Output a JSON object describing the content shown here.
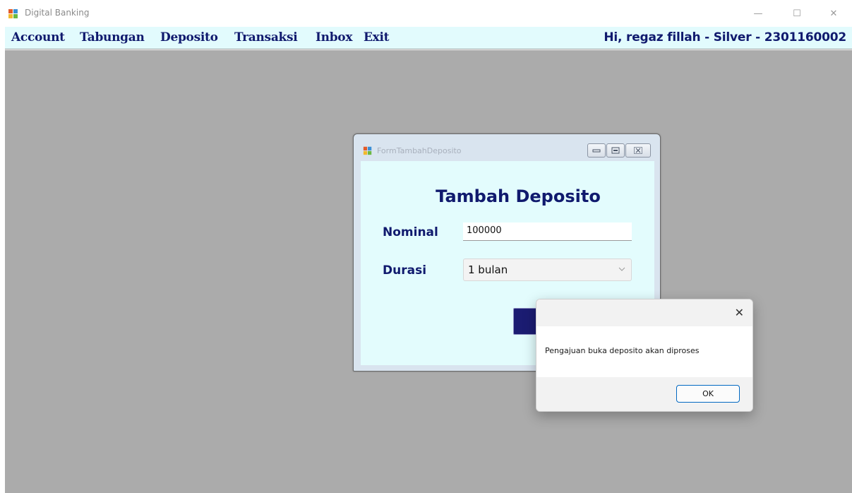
{
  "window": {
    "title": "Digital Banking",
    "controls": {
      "minimize": "—",
      "maximize": "☐",
      "close": "✕"
    }
  },
  "menu": {
    "items": [
      "Account",
      "Tabungan",
      "Deposito",
      "Transaksi",
      "Inbox",
      "Exit"
    ],
    "greeting": "Hi, regaz fillah - Silver - 2301160002"
  },
  "child_form": {
    "title": "FormTambahDeposito",
    "heading": "Tambah Deposito",
    "nominal_label": "Nominal",
    "nominal_value": "100000",
    "durasi_label": "Durasi",
    "durasi_value": "1 bulan"
  },
  "message_box": {
    "message": "Pengajuan buka deposito akan diproses",
    "ok_label": "OK",
    "close_glyph": "✕"
  },
  "colors": {
    "menu_bg": "#e2fbfd",
    "menu_text": "#101a6e",
    "mdi_bg": "#ababab",
    "form_bg": "#e3fcfd",
    "button_navy": "#1b1c72"
  },
  "icons": {
    "app": "app-window-icon",
    "dropdown": "chevron-down-icon"
  }
}
